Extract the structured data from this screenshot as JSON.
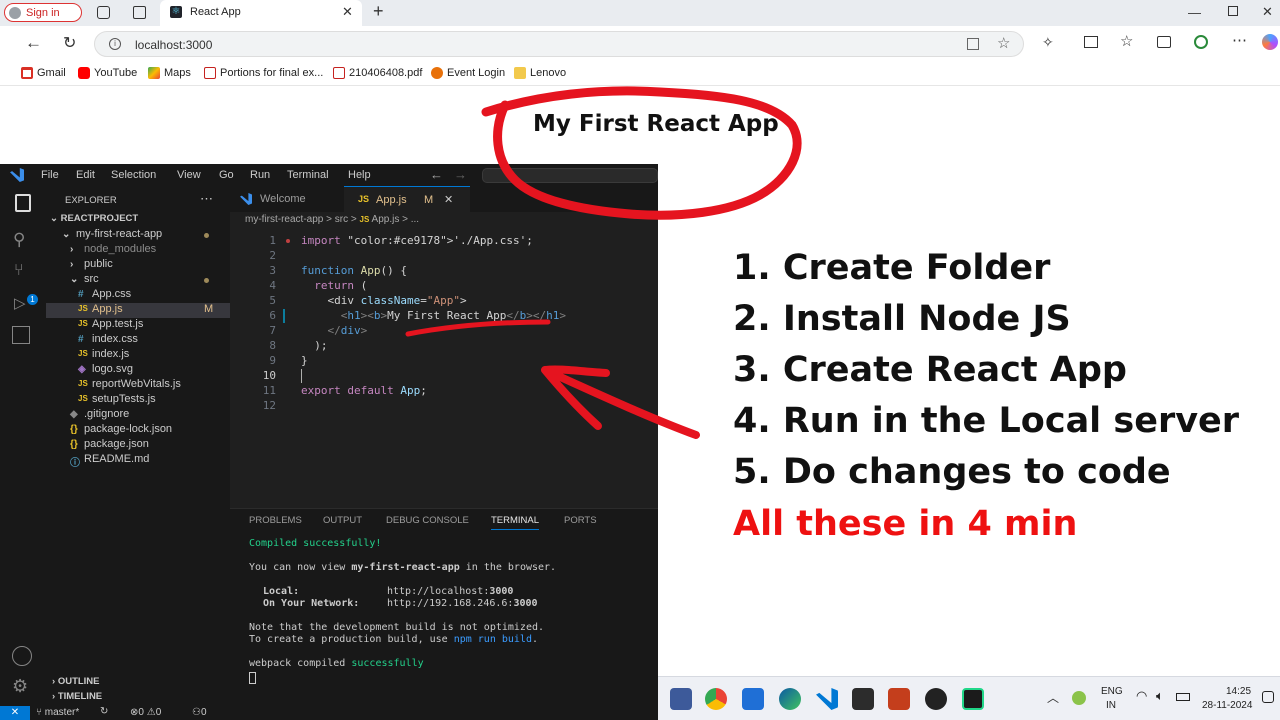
{
  "browser": {
    "profile_label": "Sign in",
    "tab_title": "React App",
    "url": "localhost:3000",
    "bookmarks": [
      {
        "label": "Gmail",
        "icon": "gmail-icon"
      },
      {
        "label": "YouTube",
        "icon": "youtube-icon"
      },
      {
        "label": "Maps",
        "icon": "maps-icon"
      },
      {
        "label": "Portions for final ex...",
        "icon": "pdf-icon"
      },
      {
        "label": "210406408.pdf",
        "icon": "pdf-icon"
      },
      {
        "label": "Event Login",
        "icon": "event-icon"
      },
      {
        "label": "Lenovo",
        "icon": "folder-icon"
      }
    ]
  },
  "page": {
    "heading": "My First React App"
  },
  "vscode": {
    "menu": [
      "File",
      "Edit",
      "Selection",
      "View",
      "Go",
      "Run",
      "Terminal",
      "Help"
    ],
    "explorer_title": "EXPLORER",
    "project_name": "REACTPROJECT",
    "tree": [
      {
        "label": "my-first-react-app",
        "kind": "folder-open"
      },
      {
        "label": "node_modules",
        "kind": "folder"
      },
      {
        "label": "public",
        "kind": "folder"
      },
      {
        "label": "src",
        "kind": "folder-open"
      },
      {
        "label": "App.css",
        "kind": "css"
      },
      {
        "label": "App.js",
        "kind": "js",
        "status": "M"
      },
      {
        "label": "App.test.js",
        "kind": "js"
      },
      {
        "label": "index.css",
        "kind": "css"
      },
      {
        "label": "index.js",
        "kind": "js"
      },
      {
        "label": "logo.svg",
        "kind": "svg"
      },
      {
        "label": "reportWebVitals.js",
        "kind": "js"
      },
      {
        "label": "setupTests.js",
        "kind": "js"
      },
      {
        "label": ".gitignore",
        "kind": "git"
      },
      {
        "label": "package-lock.json",
        "kind": "json"
      },
      {
        "label": "package.json",
        "kind": "json"
      },
      {
        "label": "README.md",
        "kind": "md"
      }
    ],
    "outline_label": "OUTLINE",
    "timeline_label": "TIMELINE",
    "tabs": [
      {
        "label": "Welcome"
      },
      {
        "label": "App.js",
        "status": "M"
      }
    ],
    "breadcrumb": {
      "folder": "my-first-react-app",
      "sep1": ">",
      "src": "src",
      "sep2": ">",
      "file": "App.js",
      "sep3": "> ..."
    },
    "line_numbers": [
      "1",
      "2",
      "3",
      "4",
      "5",
      "6",
      "7",
      "8",
      "9",
      "10",
      "11",
      "12"
    ],
    "code_lines": [
      "import './App.css';",
      "",
      "function App() {",
      "  return (",
      "    <div className=\"App\">",
      "      <h1><b>My First React App</b></h1>",
      "    </div>",
      "  );",
      "}",
      "",
      "export default App;",
      ""
    ],
    "panel_tabs": [
      "PROBLEMS",
      "OUTPUT",
      "DEBUG CONSOLE",
      "TERMINAL",
      "PORTS"
    ],
    "terminal": {
      "compiled": "Compiled successfully!",
      "view_prefix": "You can now view ",
      "app_name": "my-first-react-app",
      "view_suffix": " in the browser.",
      "local_label": "Local:",
      "local_url_prefix": "http://localhost:",
      "local_port": "3000",
      "network_label": "On Your Network:",
      "network_url_prefix": "http://192.168.246.6:",
      "network_port": "3000",
      "note1": "Note that the development build is not optimized.",
      "note2_prefix": "To create a production build, use ",
      "note2_cmd": "npm run build",
      "note2_suffix": ".",
      "webpack_prefix": "webpack compiled ",
      "webpack_status": "successfully"
    },
    "status": {
      "branch": "master*",
      "errors": "0",
      "warnings": "0",
      "ports": "0"
    }
  },
  "slide": {
    "steps": [
      "1. Create Folder",
      "2. Install Node JS",
      "3. Create React App",
      "4. Run in the Local server",
      "5. Do changes to code"
    ],
    "highlight": "All these in 4 min",
    "highlight_color": "#ee1111",
    "annotation_color": "#e5141f"
  },
  "taskbar": {
    "lang_top": "ENG",
    "lang_bottom": "IN",
    "time": "14:25",
    "date": "28-11-2024"
  }
}
